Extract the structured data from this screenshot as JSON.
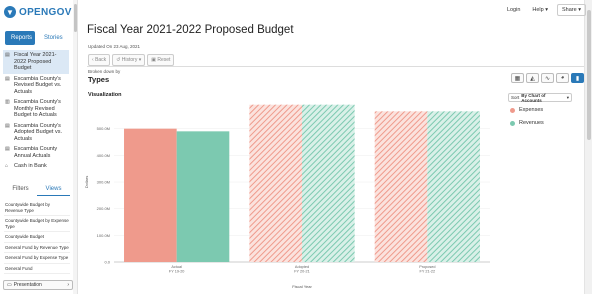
{
  "logo": {
    "text": "OPENGOV"
  },
  "sidebar": {
    "tabs": [
      {
        "label": "Reports",
        "active": true
      },
      {
        "label": "Stories",
        "active": false
      }
    ],
    "items": [
      {
        "label": "Fiscal Year 2021-2022 Proposed Budget",
        "icon": "document-icon",
        "active": true
      },
      {
        "label": "Escambia County's Revised Budget vs. Actuals",
        "icon": "document-icon"
      },
      {
        "label": "Escambia County's Monthly Revised Budget to Actuals",
        "icon": "bar-chart-icon"
      },
      {
        "label": "Escambia County's Adopted Budget vs. Actuals",
        "icon": "document-icon"
      },
      {
        "label": "Escambia County Annual Actuals",
        "icon": "document-icon"
      },
      {
        "label": "Cash in Bank",
        "icon": "bank-icon"
      }
    ],
    "subtabs": [
      {
        "label": "Filters",
        "active": false
      },
      {
        "label": "Views",
        "active": true
      }
    ],
    "views": [
      "Countywide Budget by Revenue Type",
      "Countywide Budget by Expense Type",
      "Countywide Budget",
      "General Fund by Revenue Type",
      "General Fund by Expense Type",
      "General Fund"
    ],
    "presentation": "Presentation"
  },
  "topnav": {
    "login": "Login",
    "help": "Help",
    "share": "Share"
  },
  "main": {
    "title": "Fiscal Year 2021-2022 Proposed Budget",
    "updated": "Updated On 23 Aug, 2021",
    "buttons": {
      "back": "Back",
      "history": "History",
      "reset": "Reset"
    },
    "broken_down_by": "Broken down by",
    "types": "Types",
    "visualization": "Visualization",
    "sort_prefix": "Sort",
    "sort_value": "By Chart of Accounts"
  },
  "colors": {
    "expenses": "#ef9a8c",
    "revenues": "#7cc9b0",
    "accent": "#2a79b8"
  },
  "chart_data": {
    "type": "bar",
    "categories": [
      [
        "Actual",
        "FY 19-20"
      ],
      [
        "Adopted",
        "FY 20-21"
      ],
      [
        "Proposed",
        "FY 21-22"
      ]
    ],
    "series": [
      {
        "name": "Expenses",
        "values": [
          500,
          590,
          565
        ],
        "pattern": [
          false,
          true,
          true
        ]
      },
      {
        "name": "Revenues",
        "values": [
          490,
          590,
          565
        ],
        "pattern": [
          false,
          true,
          true
        ]
      }
    ],
    "yticks": [
      "0.0",
      "100.0M",
      "200.0M",
      "300.0M",
      "400.0M",
      "500.0M"
    ],
    "ylim": [
      0,
      600
    ],
    "ylabel": "Dollars",
    "xlabel": "Fiscal Year",
    "legend": "right"
  }
}
